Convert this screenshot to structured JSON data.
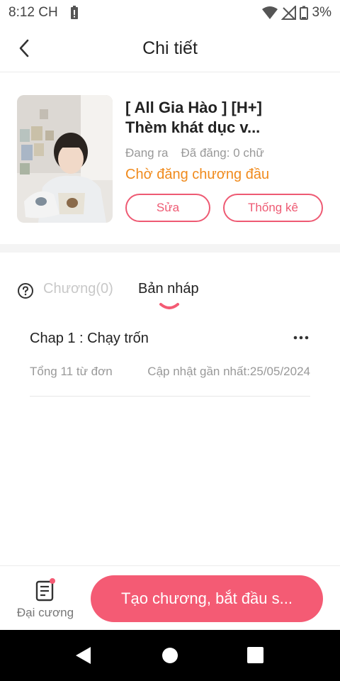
{
  "status_bar": {
    "time": "8:12 CH",
    "battery": "3%",
    "icons": [
      "battery-alert-icon",
      "wifi-icon",
      "no-signal-icon",
      "battery-icon"
    ]
  },
  "header": {
    "title": "Chi tiết",
    "back_icon": "chevron-left-icon"
  },
  "book": {
    "title_line1": "[ All Gia Hào ] [H+]",
    "title_line2": "Thèm khát dục v...",
    "status": "Đang ra",
    "words_posted": "Đã đăng: 0 chữ",
    "pending": "Chờ đăng chương đầu",
    "edit_label": "Sửa",
    "stats_label": "Thống kê"
  },
  "tabs": {
    "chapters": "Chương(0)",
    "drafts": "Bản nháp",
    "active": "drafts"
  },
  "drafts": [
    {
      "title": "Chap 1 : Chạy trốn",
      "words": "Tổng 11 từ đơn",
      "updated": "Cập nhật gần nhất:25/05/2024"
    }
  ],
  "bottom": {
    "outline_label": "Đại cương",
    "create_label": "Tạo chương, bắt đầu s..."
  },
  "colors": {
    "accent": "#f45b74",
    "pending": "#f08a1c",
    "muted": "#999999"
  }
}
